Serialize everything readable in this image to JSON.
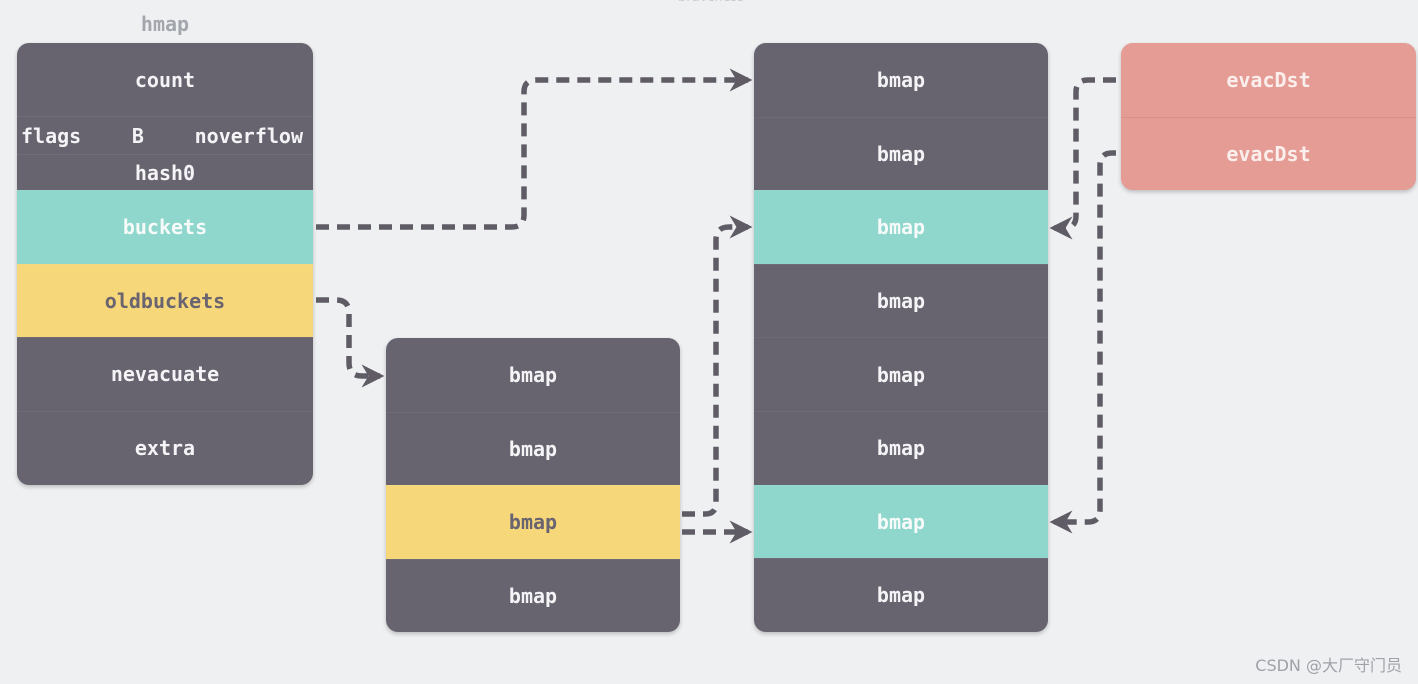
{
  "top_caption": "bravchess",
  "hmap": {
    "title": "hmap",
    "count": "count",
    "flags": "flags",
    "b": "B",
    "noverflow": "noverflow",
    "hash0": "hash0",
    "buckets": "buckets",
    "oldbuckets": "oldbuckets",
    "nevacuate": "nevacuate",
    "extra": "extra"
  },
  "old_buckets": {
    "cells": [
      {
        "label": "bmap",
        "state": "normal"
      },
      {
        "label": "bmap",
        "state": "normal"
      },
      {
        "label": "bmap",
        "state": "highlight-old"
      },
      {
        "label": "bmap",
        "state": "normal"
      }
    ]
  },
  "new_buckets": {
    "cells": [
      {
        "label": "bmap",
        "state": "normal"
      },
      {
        "label": "bmap",
        "state": "normal"
      },
      {
        "label": "bmap",
        "state": "highlight-new"
      },
      {
        "label": "bmap",
        "state": "normal"
      },
      {
        "label": "bmap",
        "state": "normal"
      },
      {
        "label": "bmap",
        "state": "normal"
      },
      {
        "label": "bmap",
        "state": "highlight-new"
      },
      {
        "label": "bmap",
        "state": "normal"
      }
    ]
  },
  "evac_dst": {
    "cells": [
      {
        "label": "evacDst"
      },
      {
        "label": "evacDst"
      }
    ]
  },
  "connections": [
    {
      "from": "hmap.buckets",
      "to": "new_buckets.0"
    },
    {
      "from": "hmap.oldbuckets",
      "to": "old_buckets.0"
    },
    {
      "from": "old_buckets.2",
      "to": "new_buckets.2"
    },
    {
      "from": "old_buckets.2",
      "to": "new_buckets.6"
    },
    {
      "from": "evac_dst.0",
      "to": "new_buckets.2"
    },
    {
      "from": "evac_dst.1",
      "to": "new_buckets.6"
    }
  ],
  "colors": {
    "background": "#eff0f2",
    "normal": "#67646f",
    "new_highlight": "#8fd6cc",
    "old_highlight": "#f6d77a",
    "evac": "#e59c94",
    "arrow": "#5f5c66"
  },
  "watermark": "CSDN @大厂守门员"
}
